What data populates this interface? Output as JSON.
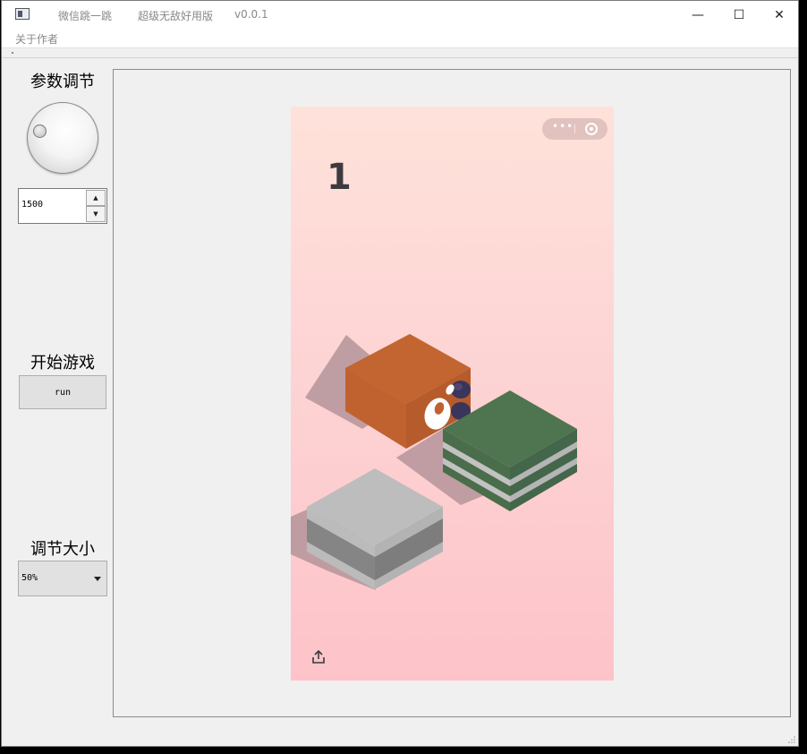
{
  "window": {
    "title_segments": [
      "微信跳一跳",
      "超级无敌好用版",
      "v0.0.1"
    ],
    "controls": {
      "minimize": "—",
      "maximize": "☐",
      "close": "✕"
    }
  },
  "menu": {
    "items": [
      "关于作者"
    ]
  },
  "left_panel": {
    "param_label": "参数调节",
    "spin_value": "1500",
    "spin_up": "▲",
    "spin_down": "▼",
    "start_label": "开始游戏",
    "run_button": "run",
    "size_label": "调节大小",
    "size_selected": "50%"
  },
  "game": {
    "score": "1",
    "capsule_dots": "•••"
  },
  "colors": {
    "orange_block": "#c0622f",
    "green_block": "#4f7450",
    "gray_block": "#bdbdbd",
    "bg_top": "#fee2da",
    "bg_bottom": "#fdc3c9"
  },
  "icons": {
    "app": "window-icon",
    "dial": "dial-knob",
    "share": "share-icon",
    "capsule": "mini-program-capsule"
  }
}
